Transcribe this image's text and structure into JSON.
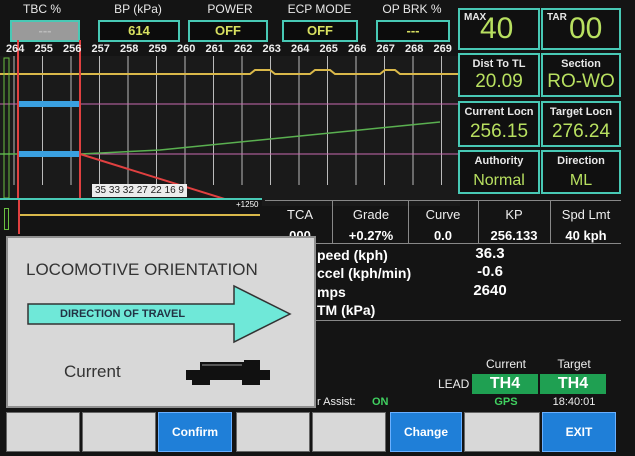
{
  "header": [
    {
      "label": "TBC %",
      "value": "---"
    },
    {
      "label": "BP (kPa)",
      "value": "614"
    },
    {
      "label": "POWER",
      "value": "OFF"
    },
    {
      "label": "ECP MODE",
      "value": "OFF"
    },
    {
      "label": "OP BRK %",
      "value": "---"
    }
  ],
  "km_ticks": [
    "264",
    "255",
    "256",
    "257",
    "258",
    "259",
    "260",
    "261",
    "262",
    "263",
    "264",
    "265",
    "266",
    "267",
    "268",
    "269"
  ],
  "consist_numbers": "35 33 32 27 22 16 9",
  "track_marker": "+1250",
  "right_panel": {
    "max_label": "MAX",
    "max_value": "40",
    "tar_label": "TAR",
    "tar_value": "00",
    "dist_to_tl_label": "Dist To TL",
    "dist_to_tl_value": "20.09",
    "section_label": "Section",
    "section_value": "RO-WO",
    "current_locn_label": "Current Locn",
    "current_locn_value": "256.15",
    "target_locn_label": "Target Locn",
    "target_locn_value": "276.24",
    "authority_label": "Authority",
    "authority_value": "Normal",
    "direction_label": "Direction",
    "direction_value": "ML"
  },
  "table": {
    "headers": [
      "TCA",
      "Grade",
      "Curve",
      "KP",
      "Spd Lmt"
    ],
    "values": [
      "000",
      "+0.27%",
      "0.0",
      "256.133",
      "40 kph"
    ]
  },
  "readouts": [
    {
      "label": "peed (kph)",
      "value": "36.3"
    },
    {
      "label": "ccel (kph/min)",
      "value": "-0.6"
    },
    {
      "label": "mps",
      "value": "2640"
    },
    {
      "label": "TM (kPa)",
      "value": ""
    }
  ],
  "assist": {
    "label": "r Assist:",
    "value": "ON"
  },
  "lead": {
    "label": "LEAD",
    "current_header": "Current",
    "target_header": "Target",
    "current_value": "TH4",
    "target_value": "TH4",
    "gps_label": "GPS",
    "time": "18:40:01"
  },
  "overlay": {
    "title": "LOCOMOTIVE ORIENTATION",
    "arrow_text": "DIRECTION OF TRAVEL",
    "current_label": "Current"
  },
  "buttons": [
    "",
    "",
    "Confirm",
    "",
    "",
    "Change",
    "",
    "EXIT"
  ],
  "colors": {
    "accent_teal": "#48c9b5",
    "value_green": "#b8e060",
    "lead_green": "#1fa052",
    "button_blue": "#1f7fd8"
  }
}
